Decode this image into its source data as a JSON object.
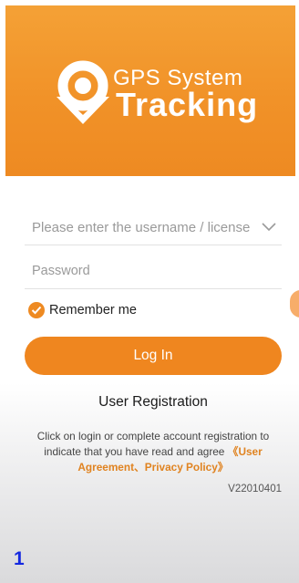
{
  "header": {
    "brand_line1": "GPS System",
    "brand_line2": "Tracking",
    "logo_icon": "location-pin-icon"
  },
  "login_form": {
    "username_placeholder": "Please enter the username / license",
    "username_dropdown_icon": "chevron-down-icon",
    "password_placeholder": "Password",
    "remember_label": "Remember me",
    "remember_checked": true,
    "login_label": "Log In"
  },
  "registration": {
    "label": "User Registration"
  },
  "agreement": {
    "text_line": "Click on login or complete account registration to indicate that you have read and agree",
    "link_text": "《User Agreement、Privacy Policy》"
  },
  "version": "V22010401",
  "step_marker": "1",
  "colors": {
    "accent": "#ee8a22",
    "header_top": "#f4a136",
    "step_marker": "#1428e0"
  }
}
